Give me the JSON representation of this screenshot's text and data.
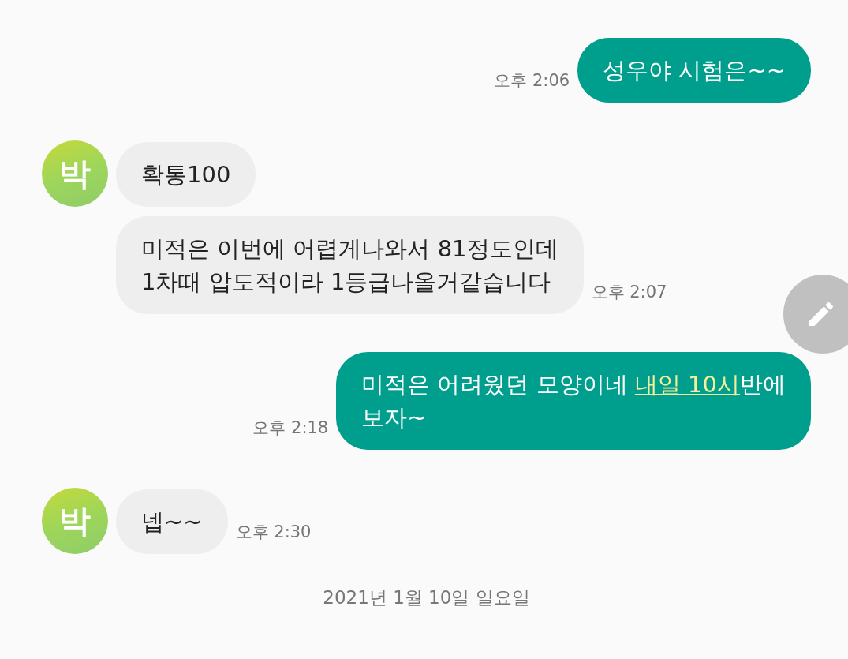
{
  "messages": [
    {
      "kind": "sent",
      "segments": [
        {
          "text": "성우야 시험은~~",
          "link": false
        }
      ],
      "time": "오후 2:06"
    },
    {
      "kind": "received",
      "show_avatar": true,
      "avatar": "박",
      "segments": [
        {
          "text": "확통100",
          "link": false
        }
      ]
    },
    {
      "kind": "received",
      "show_avatar": false,
      "segments": [
        {
          "text": "미적은 이번에 어렵게나와서 81정도인데\n1차때 압도적이라 1등급나올거같습니다",
          "link": false
        }
      ],
      "time": "오후 2:07"
    },
    {
      "kind": "sent",
      "segments": [
        {
          "text": "미적은 어려웠던 모양이네 ",
          "link": false
        },
        {
          "text": "내일 10시",
          "link": true
        },
        {
          "text": "반에\n보자~",
          "link": false
        }
      ],
      "time": "오후 2:18"
    },
    {
      "kind": "received",
      "show_avatar": true,
      "avatar": "박",
      "segments": [
        {
          "text": "넵~~",
          "link": false
        }
      ],
      "time": "오후 2:30"
    }
  ],
  "date_divider": "2021년 1월 10일 일요일",
  "fab": {
    "kind": "edit"
  }
}
